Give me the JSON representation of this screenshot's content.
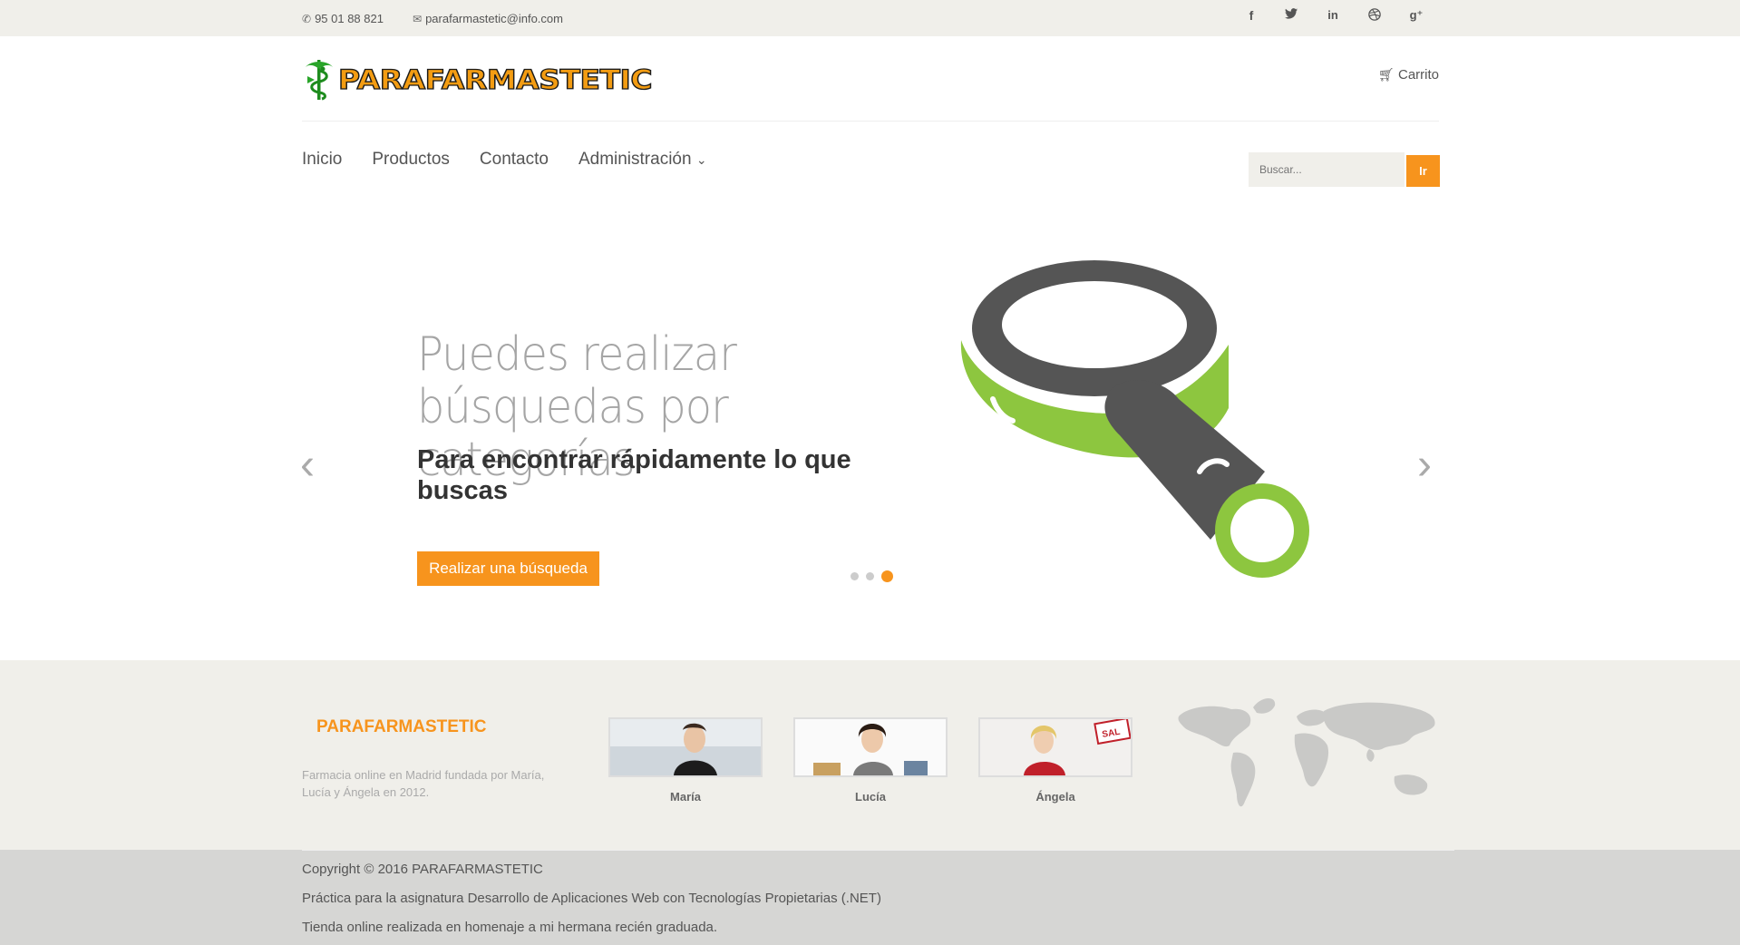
{
  "topbar": {
    "phone": "95 01 88 821",
    "email": "parafarmastetic@info.com",
    "social": [
      "f",
      "t",
      "in",
      "dr",
      "g+"
    ]
  },
  "header": {
    "brand": "PARAFARMASTETIC",
    "cart_label": "Carrito"
  },
  "nav": {
    "items": [
      "Inicio",
      "Productos",
      "Contacto",
      "Administración"
    ],
    "search_placeholder": "Buscar...",
    "search_button": "Ir"
  },
  "slider": {
    "title": "Puedes realizar búsquedas por categorías",
    "subtitle": "Para encontrar rápidamente lo que buscas",
    "button": "Realizar una búsqueda",
    "active_slide": 3,
    "total_slides": 3
  },
  "footer": {
    "brand": "PARAFARMASTETIC",
    "description": "Farmacia online en Madrid fundada por María, Lucía y Ángela en 2012.",
    "members": [
      "María",
      "Lucía",
      "Ángela"
    ],
    "copyright": "Copyright © 2016 PARAFARMASTETIC",
    "line2": "Práctica para la asignatura Desarrollo de Aplicaciones Web con Tecnologías Propietarias (.NET)",
    "line3": "Tienda online realizada en homenaje a mi hermana recién graduada."
  },
  "colors": {
    "accent": "#f7941d",
    "topbar_bg": "#f0efea",
    "footer_bg": "#d6d6d4"
  }
}
